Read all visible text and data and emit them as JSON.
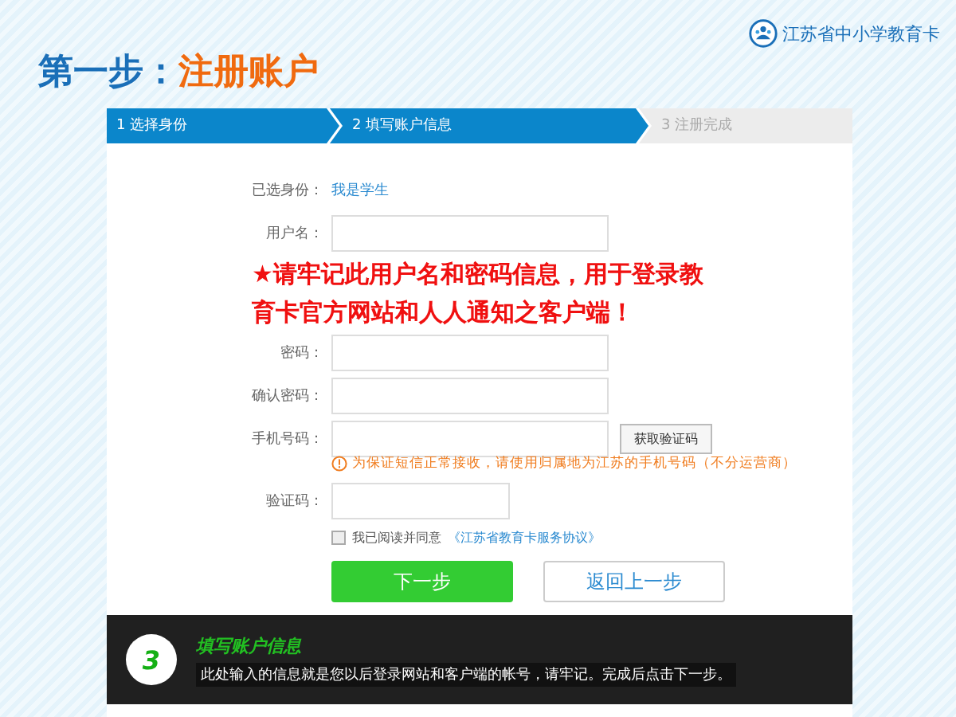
{
  "header": {
    "step": "第一步：",
    "title": "注册账户",
    "brand": "江苏省中小学教育卡"
  },
  "steps": [
    {
      "label": "1 选择身份",
      "active": true
    },
    {
      "label": "2 填写账户信息",
      "active": true
    },
    {
      "label": "3 注册完成",
      "active": false
    }
  ],
  "form": {
    "identity": {
      "label": "已选身份：",
      "value": "我是学生"
    },
    "fields": [
      {
        "label": "用户名：",
        "kind": "wide"
      },
      {
        "label": "密码：",
        "kind": "wide"
      },
      {
        "label": "确认密码：",
        "kind": "wide"
      },
      {
        "label": "手机号码：",
        "kind": "wide",
        "button": "获取验证码",
        "hint": "为保证短信正常接收，请使用归属地为江苏的手机号码（不分运营商）"
      },
      {
        "label": "验证码：",
        "kind": "short"
      }
    ],
    "agreement": {
      "checked": false,
      "text": "我已阅读并同意",
      "link": "《江苏省教育卡服务协议》"
    },
    "buttons": [
      {
        "label": "下一步",
        "kind": "primary"
      },
      {
        "label": "返回上一步",
        "kind": "secondary"
      }
    ]
  },
  "notice": "★请牢记此用户名和密码信息，用于登录教育卡官方网站和人人通知之客户端！",
  "tip": {
    "number": "3",
    "title": "填写账户信息",
    "text": "此处输入的信息就是您以后登录网站和客户端的帐号，请牢记。完成后点击下一步。"
  }
}
